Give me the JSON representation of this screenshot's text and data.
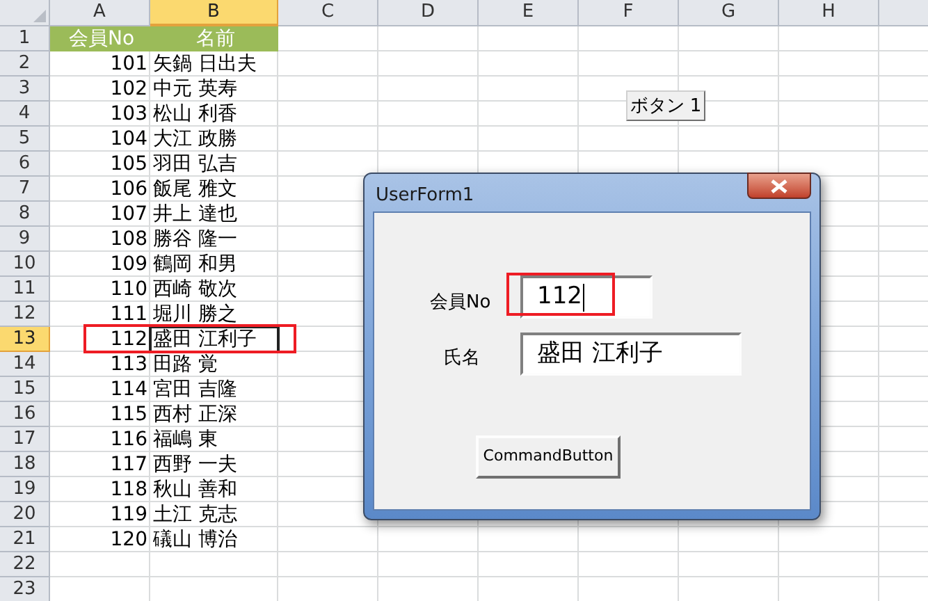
{
  "columns": [
    {
      "label": "A",
      "selected": false
    },
    {
      "label": "B",
      "selected": true
    },
    {
      "label": "C",
      "selected": false
    },
    {
      "label": "D",
      "selected": false
    },
    {
      "label": "E",
      "selected": false
    },
    {
      "label": "F",
      "selected": false
    },
    {
      "label": "G",
      "selected": false
    },
    {
      "label": "H",
      "selected": false
    }
  ],
  "rows": [
    {
      "number": "1",
      "kind": "header",
      "selected": false,
      "highlighted": false,
      "cells": [
        "会員No",
        "名前"
      ]
    },
    {
      "number": "2",
      "kind": "data",
      "selected": false,
      "highlighted": false,
      "cells": [
        "101",
        "矢鍋 日出夫"
      ]
    },
    {
      "number": "3",
      "kind": "data",
      "selected": false,
      "highlighted": false,
      "cells": [
        "102",
        "中元 英寿"
      ]
    },
    {
      "number": "4",
      "kind": "data",
      "selected": false,
      "highlighted": false,
      "cells": [
        "103",
        "松山 利香"
      ]
    },
    {
      "number": "5",
      "kind": "data",
      "selected": false,
      "highlighted": false,
      "cells": [
        "104",
        "大江 政勝"
      ]
    },
    {
      "number": "6",
      "kind": "data",
      "selected": false,
      "highlighted": false,
      "cells": [
        "105",
        "羽田 弘吉"
      ]
    },
    {
      "number": "7",
      "kind": "data",
      "selected": false,
      "highlighted": false,
      "cells": [
        "106",
        "飯尾 雅文"
      ]
    },
    {
      "number": "8",
      "kind": "data",
      "selected": false,
      "highlighted": false,
      "cells": [
        "107",
        "井上 達也"
      ]
    },
    {
      "number": "9",
      "kind": "data",
      "selected": false,
      "highlighted": false,
      "cells": [
        "108",
        "勝谷 隆一"
      ]
    },
    {
      "number": "10",
      "kind": "data",
      "selected": false,
      "highlighted": false,
      "cells": [
        "109",
        "鶴岡 和男"
      ]
    },
    {
      "number": "11",
      "kind": "data",
      "selected": false,
      "highlighted": false,
      "cells": [
        "110",
        "西崎 敬次"
      ]
    },
    {
      "number": "12",
      "kind": "data",
      "selected": false,
      "highlighted": false,
      "cells": [
        "111",
        "堀川 勝之"
      ]
    },
    {
      "number": "13",
      "kind": "data",
      "selected": true,
      "highlighted": true,
      "cells": [
        "112",
        "盛田 江利子"
      ]
    },
    {
      "number": "14",
      "kind": "data",
      "selected": false,
      "highlighted": false,
      "cells": [
        "113",
        "田路 覚"
      ]
    },
    {
      "number": "15",
      "kind": "data",
      "selected": false,
      "highlighted": false,
      "cells": [
        "114",
        "宮田 吉隆"
      ]
    },
    {
      "number": "16",
      "kind": "data",
      "selected": false,
      "highlighted": false,
      "cells": [
        "115",
        "西村 正深"
      ]
    },
    {
      "number": "17",
      "kind": "data",
      "selected": false,
      "highlighted": false,
      "cells": [
        "116",
        "福嶋 東"
      ]
    },
    {
      "number": "18",
      "kind": "data",
      "selected": false,
      "highlighted": false,
      "cells": [
        "117",
        "西野 一夫"
      ]
    },
    {
      "number": "19",
      "kind": "data",
      "selected": false,
      "highlighted": false,
      "cells": [
        "118",
        "秋山 善和"
      ]
    },
    {
      "number": "20",
      "kind": "data",
      "selected": false,
      "highlighted": false,
      "cells": [
        "119",
        "土江 克志"
      ]
    },
    {
      "number": "21",
      "kind": "data",
      "selected": false,
      "highlighted": false,
      "cells": [
        "120",
        "礒山 博治"
      ]
    },
    {
      "number": "22",
      "kind": "data",
      "selected": false,
      "highlighted": false,
      "cells": []
    },
    {
      "number": "23",
      "kind": "data",
      "selected": false,
      "highlighted": false,
      "cells": []
    }
  ],
  "sheet_button": "ボタン 1",
  "dialog": {
    "title": "UserForm1",
    "fields": [
      {
        "label": "会員No",
        "value": "112",
        "highlighted": true,
        "focused": true
      },
      {
        "label": "氏名",
        "value": "盛田 江利子",
        "highlighted": false,
        "focused": false
      }
    ],
    "button": "CommandButton"
  }
}
